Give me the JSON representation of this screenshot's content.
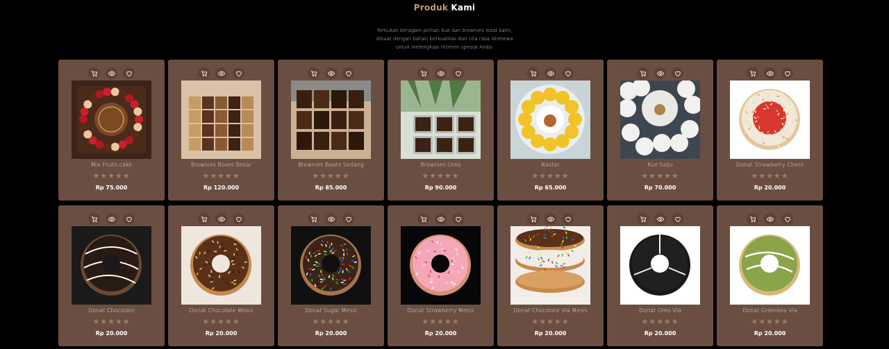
{
  "section": {
    "title_accent": "Produk",
    "title_main": "Kami",
    "subtitle_lines": [
      "Temukan beragam pilihan kue dan brownies lezat kami,",
      "dibuat dengan bahan berkualitas dan cita rasa istimewa",
      "untuk melengkapi momen spesial Anda."
    ]
  },
  "card_icons": [
    "cart-icon",
    "eye-icon",
    "heart-icon"
  ],
  "rating_stars": "★★★★★",
  "colors": {
    "card_bg": "#6b4e42",
    "accent": "#c49a6c",
    "star": "#9b7f6c"
  },
  "products": [
    {
      "name": "Mix Fruits cake",
      "price": "Rp 75.000",
      "image": "fruit-cake-photo"
    },
    {
      "name": "Brownies Boxes Besar",
      "price": "Rp 120.000",
      "image": "brownies-box-large-photo"
    },
    {
      "name": "Brownies Boxes Sedang",
      "price": "Rp 85.000",
      "image": "brownies-box-medium-photo"
    },
    {
      "name": "Brownies Oreo",
      "price": "Rp 90.000",
      "image": "brownies-oreo-photo"
    },
    {
      "name": "Nastar",
      "price": "Rp 65.000",
      "image": "nastar-photo"
    },
    {
      "name": "Kue Salju",
      "price": "Rp 70.000",
      "image": "kue-salju-photo"
    },
    {
      "name": "Donat Strawberry Chess",
      "price": "Rp 20.000",
      "image": "donut-strawberry-cheese-photo"
    },
    {
      "name": "Donat Chocolate",
      "price": "Rp 20.000",
      "image": "donut-chocolate-photo"
    },
    {
      "name": "Donat Chocolate Mesis",
      "price": "Rp 20.000",
      "image": "donut-chocolate-sprinkles-photo"
    },
    {
      "name": "Donat Sugar Mesis",
      "price": "Rp 20.000",
      "image": "donut-sugar-sprinkles-photo"
    },
    {
      "name": "Donat Strawberry Mesis",
      "price": "Rp 20.000",
      "image": "donut-strawberry-sprinkles-photo"
    },
    {
      "name": "Donat Chocolate Vla Mesis",
      "price": "Rp 20.000",
      "image": "donut-stack-photo"
    },
    {
      "name": "Donat Oreo Vla",
      "price": "Rp 20.000",
      "image": "donut-oreo-photo"
    },
    {
      "name": "Donat Greentea Vla",
      "price": "Rp 20.000",
      "image": "donut-greentea-photo"
    }
  ]
}
